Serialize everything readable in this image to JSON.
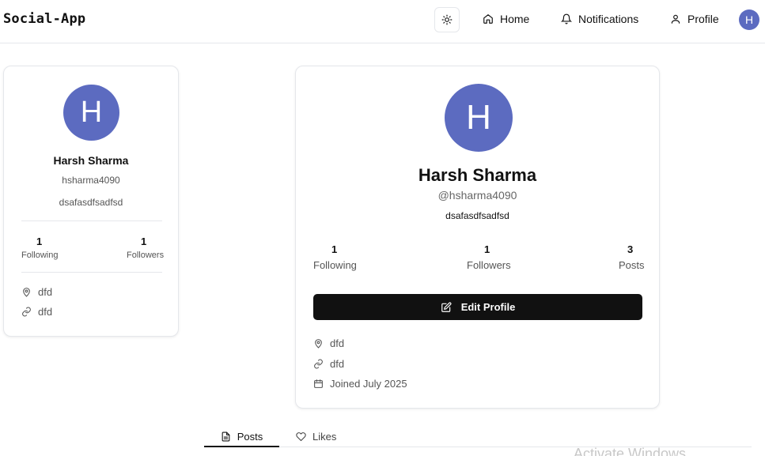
{
  "header": {
    "brand": "Social-App",
    "nav": {
      "home": "Home",
      "notifications": "Notifications",
      "profile": "Profile"
    },
    "avatar_initial": "H"
  },
  "sidebar_card": {
    "avatar_initial": "H",
    "name": "Harsh Sharma",
    "username": "hsharma4090",
    "bio": "dsafasdfsadfsd",
    "stats": {
      "following_count": "1",
      "following_label": "Following",
      "followers_count": "1",
      "followers_label": "Followers"
    },
    "location": "dfd",
    "website": "dfd"
  },
  "profile_card": {
    "avatar_initial": "H",
    "name": "Harsh Sharma",
    "username": "@hsharma4090",
    "bio": "dsafasdfsadfsd",
    "stats": {
      "following_count": "1",
      "following_label": "Following",
      "followers_count": "1",
      "followers_label": "Followers",
      "posts_count": "3",
      "posts_label": "Posts"
    },
    "edit_button": "Edit Profile",
    "location": "dfd",
    "website": "dfd",
    "joined": "Joined July 2025"
  },
  "tabs": {
    "posts": "Posts",
    "likes": "Likes",
    "active": "Posts"
  },
  "watermark": "Activate Windows",
  "colors": {
    "avatar": "#5c6bc0",
    "button": "#111111",
    "border": "#e5e7eb"
  }
}
